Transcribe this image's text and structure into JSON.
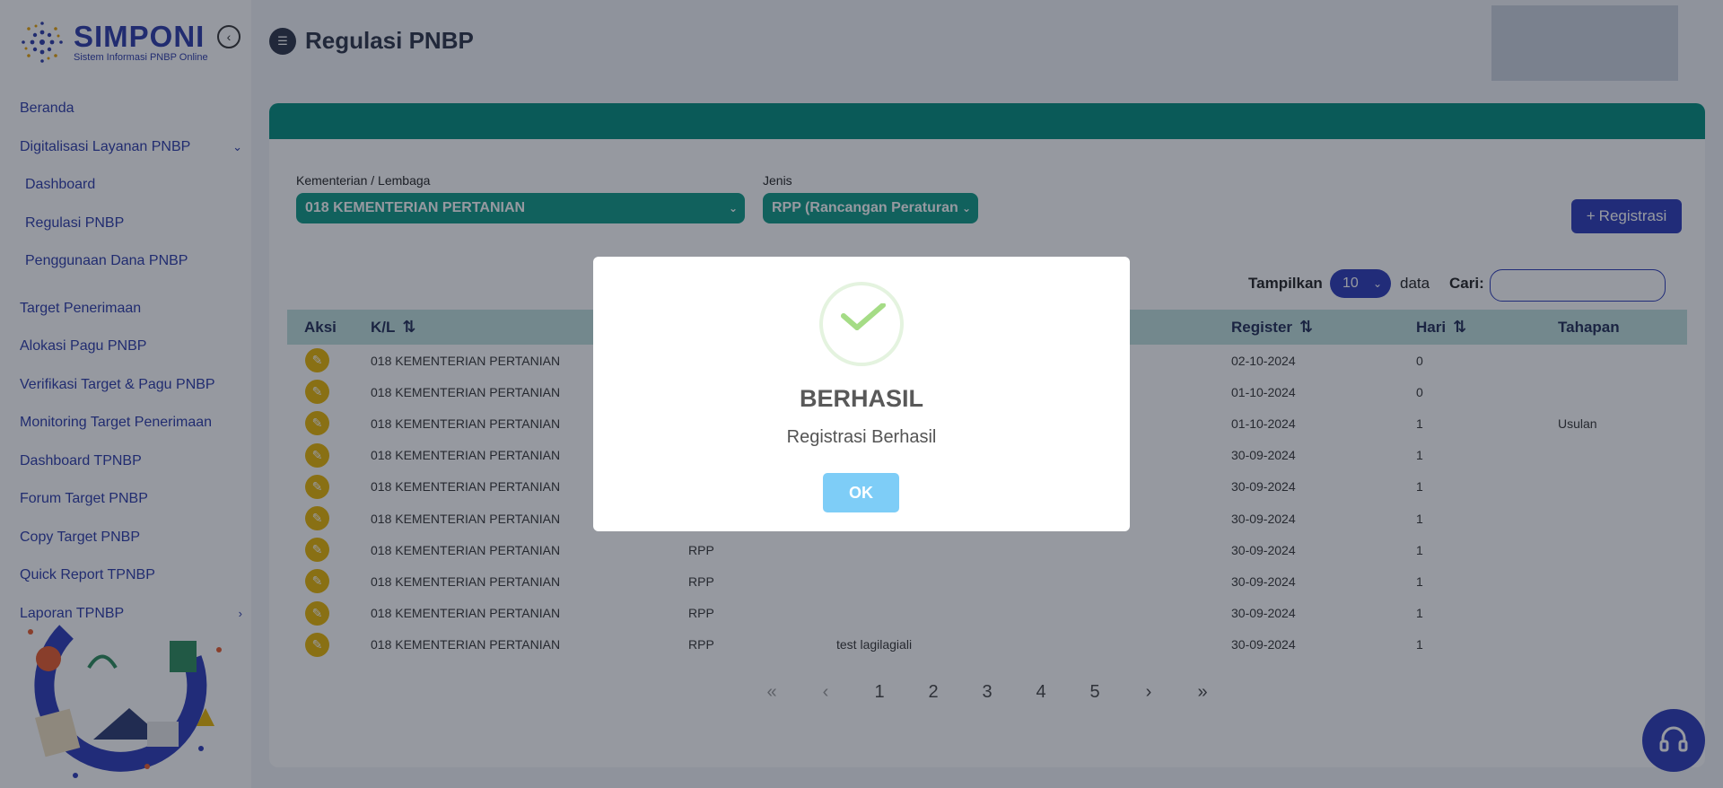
{
  "app": {
    "logo_title": "SIMPONI",
    "logo_subtitle": "Sistem Informasi PNBP Online"
  },
  "sidebar": {
    "items": [
      {
        "label": "Beranda"
      },
      {
        "label": "Digitalisasi Layanan PNBP"
      },
      {
        "label": "Dashboard"
      },
      {
        "label": "Regulasi PNBP"
      },
      {
        "label": "Penggunaan Dana PNBP"
      },
      {
        "label": "Target Penerimaan"
      },
      {
        "label": "Alokasi Pagu PNBP"
      },
      {
        "label": "Verifikasi Target & Pagu PNBP"
      },
      {
        "label": "Monitoring Target Penerimaan"
      },
      {
        "label": "Dashboard TPNBP"
      },
      {
        "label": "Forum Target PNBP"
      },
      {
        "label": "Copy Target PNBP"
      },
      {
        "label": "Quick Report TPNBP"
      },
      {
        "label": "Laporan TPNBP"
      }
    ]
  },
  "page": {
    "title": "Regulasi PNBP"
  },
  "filters": {
    "kl_label": "Kementerian / Lembaga",
    "kl_value": "018 KEMENTERIAN PERTANIAN",
    "jenis_label": "Jenis",
    "jenis_value": "RPP (Rancangan Peraturan"
  },
  "toolbar": {
    "register_label": "Registrasi",
    "show_label": "Tampilkan",
    "page_size": "10",
    "data_label": "data",
    "search_label": "Cari:"
  },
  "table": {
    "headers": {
      "aksi": "Aksi",
      "kl": "K/L",
      "register": "Register",
      "hari": "Hari",
      "tahapan": "Tahapan"
    },
    "rows": [
      {
        "kl": "018 KEMENTERIAN PERTANIAN",
        "jenis": "",
        "judul": "",
        "register": "02-10-2024",
        "hari": "0",
        "tahapan": ""
      },
      {
        "kl": "018 KEMENTERIAN PERTANIAN",
        "jenis": "",
        "judul": "",
        "register": "01-10-2024",
        "hari": "0",
        "tahapan": ""
      },
      {
        "kl": "018 KEMENTERIAN PERTANIAN",
        "jenis": "",
        "judul": "",
        "register": "01-10-2024",
        "hari": "1",
        "tahapan": "Usulan"
      },
      {
        "kl": "018 KEMENTERIAN PERTANIAN",
        "jenis": "",
        "judul": "",
        "register": "30-09-2024",
        "hari": "1",
        "tahapan": ""
      },
      {
        "kl": "018 KEMENTERIAN PERTANIAN",
        "jenis": "",
        "judul": "",
        "register": "30-09-2024",
        "hari": "1",
        "tahapan": ""
      },
      {
        "kl": "018 KEMENTERIAN PERTANIAN",
        "jenis": "",
        "judul": "",
        "register": "30-09-2024",
        "hari": "1",
        "tahapan": ""
      },
      {
        "kl": "018 KEMENTERIAN PERTANIAN",
        "jenis": "RPP",
        "judul": "",
        "register": "30-09-2024",
        "hari": "1",
        "tahapan": ""
      },
      {
        "kl": "018 KEMENTERIAN PERTANIAN",
        "jenis": "RPP",
        "judul": "",
        "register": "30-09-2024",
        "hari": "1",
        "tahapan": ""
      },
      {
        "kl": "018 KEMENTERIAN PERTANIAN",
        "jenis": "RPP",
        "judul": "",
        "register": "30-09-2024",
        "hari": "1",
        "tahapan": ""
      },
      {
        "kl": "018 KEMENTERIAN PERTANIAN",
        "jenis": "RPP",
        "judul": "test lagilagiali",
        "register": "30-09-2024",
        "hari": "1",
        "tahapan": ""
      }
    ]
  },
  "pagination": {
    "first": "«",
    "prev": "‹",
    "pages": [
      "1",
      "2",
      "3",
      "4",
      "5"
    ],
    "next": "›",
    "last": "»"
  },
  "modal": {
    "title": "BERHASIL",
    "message": "Registrasi Berhasil",
    "ok_label": "OK"
  },
  "icons": {
    "collapse": "chevron-left-circle-icon",
    "edit": "pencil-icon",
    "success": "check-icon",
    "help": "headset-icon"
  },
  "colors": {
    "brand": "#2b3ab8",
    "teal": "#008c7c",
    "edit_yellow": "#e8b400",
    "ok_button": "#7ecdf7"
  }
}
